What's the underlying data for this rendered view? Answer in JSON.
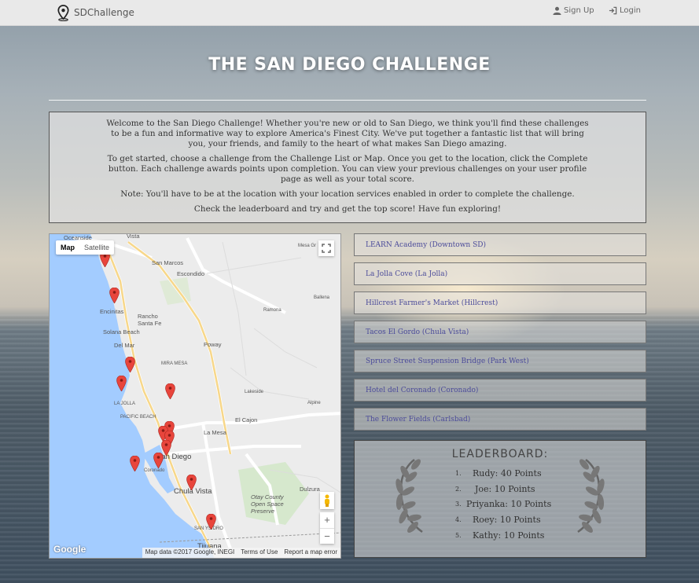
{
  "navbar": {
    "brand": "SDChallenge",
    "signup_label": "Sign Up",
    "login_label": "Login"
  },
  "header": {
    "title": "THE SAN DIEGO CHALLENGE"
  },
  "intro": {
    "paragraphs": [
      "Welcome to the San Diego Challenge! Whether you're new or old to San Diego, we think you'll find these challenges to be a fun and informative way to explore America's Finest City. We've put together a fantastic list that will bring you, your friends, and family to the heart of what makes San Diego amazing.",
      "To get started, choose a challenge from the Challenge List or Map. Once you get to the location, click the Complete button. Each challenge awards points upon completion. You can view your previous challenges on your user profile page as well as your total score.",
      "Note: You'll have to be at the location with your location services enabled in order to complete the challenge.",
      "Check the leaderboard and try and get the top score! Have fun exploring!"
    ]
  },
  "map": {
    "type_options": [
      "Map",
      "Satellite"
    ],
    "selected_type": "Map",
    "labels": [
      "Oceanside",
      "Vista",
      "Mesa Gr",
      "San Marcos",
      "Escondido",
      "Encinitas",
      "Rancho Santa Fe",
      "Ballena",
      "Ramona",
      "Solana Beach",
      "Del Mar",
      "Poway",
      "MIRA MESA",
      "LA JOLLA",
      "Lakeside",
      "PACIFIC BEACH",
      "El Cajon",
      "Alpine",
      "La Mesa",
      "San Diego",
      "Coronado",
      "Chula Vista",
      "Dulzura",
      "Otay County Open Space Preserve",
      "SAN YSIDRO",
      "Tijuana"
    ],
    "logo": "Google",
    "footer": [
      "Map data ©2017 Google, INEGI",
      "Terms of Use",
      "Report a map error"
    ],
    "zoom_in": "+",
    "zoom_out": "−",
    "colors": {
      "water": "#a3ccff",
      "land": "#ececec",
      "pin": "#e8453c"
    }
  },
  "challenges": [
    "LEARN Academy (Downtown SD)",
    "La Jolla Cove (La Jolla)",
    "Hillcrest Farmer's Market (Hillcrest)",
    "Tacos El Gordo (Chula Vista)",
    "Spruce Street Suspension Bridge (Park West)",
    "Hotel del Coronado (Coronado)",
    "The Flower Fields (Carlsbad)"
  ],
  "leaderboard": {
    "title": "LEADERBOARD:",
    "entries": [
      {
        "rank": "1.",
        "name": "Rudy:",
        "points": "40 Points"
      },
      {
        "rank": "2.",
        "name": "Joe:",
        "points": "10 Points"
      },
      {
        "rank": "3.",
        "name": "Priyanka:",
        "points": "10 Points"
      },
      {
        "rank": "4.",
        "name": "Roey:",
        "points": "10 Points"
      },
      {
        "rank": "5.",
        "name": "Kathy:",
        "points": "10 Points"
      }
    ]
  }
}
